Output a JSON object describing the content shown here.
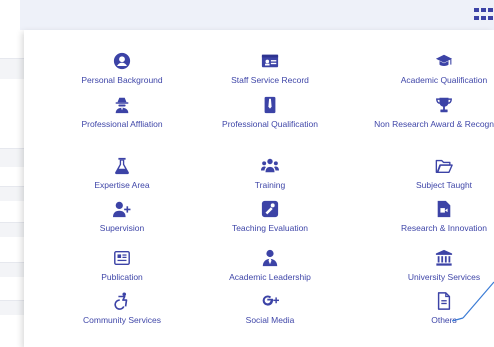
{
  "menu": {
    "items": [
      {
        "label": "Personal Background",
        "icon": "user-circle-icon"
      },
      {
        "label": "Staff Service Record",
        "icon": "id-card-icon"
      },
      {
        "label": "Academic Qualification",
        "icon": "graduation-cap-icon"
      },
      {
        "label": "Professional Affliation",
        "icon": "user-secret-icon"
      },
      {
        "label": "Professional Qualification",
        "icon": "id-badge-icon"
      },
      {
        "label": "Non Research Award & Recognitions",
        "icon": "trophy-icon"
      },
      {
        "label": "Expertise Area",
        "icon": "flask-icon"
      },
      {
        "label": "Training",
        "icon": "users-icon"
      },
      {
        "label": "Subject Taught",
        "icon": "folder-open-icon"
      },
      {
        "label": "Supervision",
        "icon": "user-plus-icon"
      },
      {
        "label": "Teaching Evaluation",
        "icon": "teaching-icon"
      },
      {
        "label": "Research & Innovation",
        "icon": "file-video-icon"
      },
      {
        "label": "Publication",
        "icon": "newspaper-icon"
      },
      {
        "label": "Academic Leadership",
        "icon": "user-tie-icon"
      },
      {
        "label": "University Services",
        "icon": "university-icon"
      },
      {
        "label": "Community Services",
        "icon": "wheelchair-icon"
      },
      {
        "label": "Social Media",
        "icon": "google-plus-icon"
      },
      {
        "label": "Others",
        "icon": "file-alt-icon"
      }
    ]
  },
  "colors": {
    "accent": "#3c43a6",
    "label": "#3f46a8",
    "panel": "#ffffff",
    "background": "#eef1f9"
  }
}
